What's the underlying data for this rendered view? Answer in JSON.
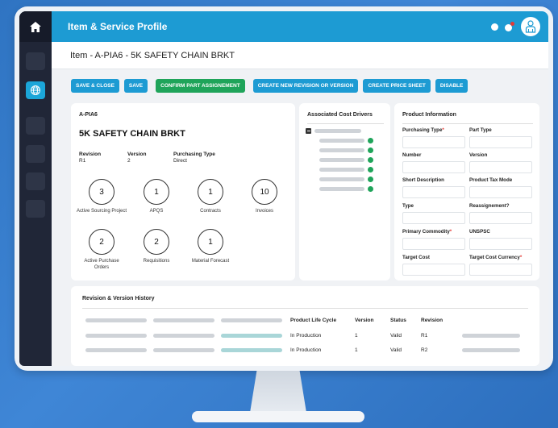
{
  "app": {
    "title": "Item & Service Profile"
  },
  "item": {
    "title": "Item - A-PIA6 - 5K SAFETY CHAIN BRKT"
  },
  "actions": {
    "save_close": "SAVE & CLOSE",
    "save": "SAVE",
    "confirm_part": "CONFIRM PART ASSIGNEMENT",
    "new_revision": "CREATE NEW REVISION OR VERSION",
    "price_sheet": "CREATE PRICE SHEET",
    "disable": "DISABLE"
  },
  "overview": {
    "code": "A-PIA6",
    "name": "5K SAFETY CHAIN BRKT",
    "revision_label": "Revision",
    "revision_value": "R1",
    "version_label": "Version",
    "version_value": "2",
    "purchasing_type_label": "Purchasing Type",
    "purchasing_type_value": "Direct",
    "metrics": [
      {
        "value": "3",
        "label": "Active Sourcing Project"
      },
      {
        "value": "1",
        "label": "APQS"
      },
      {
        "value": "1",
        "label": "Contracts"
      },
      {
        "value": "10",
        "label": "Invoices"
      },
      {
        "value": "2",
        "label": "Active Purchase Orders"
      },
      {
        "value": "2",
        "label": "Requisitions"
      },
      {
        "value": "1",
        "label": "Material Forecast"
      }
    ]
  },
  "cost_drivers": {
    "title": "Associated Cost Drivers"
  },
  "product_info": {
    "title": "Product Information",
    "fields": [
      {
        "label": "Purchasing Type",
        "required": "*"
      },
      {
        "label": "Part Type",
        "required": ""
      },
      {
        "label": "Number",
        "required": ""
      },
      {
        "label": "Version",
        "required": ""
      },
      {
        "label": "Short Description",
        "required": ""
      },
      {
        "label": "Product Tax Mode",
        "required": ""
      },
      {
        "label": "Type",
        "required": ""
      },
      {
        "label": "Reassignement?",
        "required": ""
      },
      {
        "label": "Primary Commodity",
        "required": "*"
      },
      {
        "label": "UNSPSC",
        "required": ""
      },
      {
        "label": "Target Cost",
        "required": ""
      },
      {
        "label": "Target Cost Currency",
        "required": "*"
      }
    ]
  },
  "history": {
    "title": "Revision & Version History",
    "headers": {
      "lifecycle": "Product Life Cycle",
      "version": "Version",
      "status": "Status",
      "revision": "Revision"
    },
    "rows": [
      {
        "lifecycle": "In Production",
        "version": "1",
        "status": "Valid",
        "revision": "R1"
      },
      {
        "lifecycle": "In Production",
        "version": "1",
        "status": "Valid",
        "revision": "R2"
      }
    ]
  },
  "colors": {
    "topbar": "#1d9bd3",
    "sidebar": "#202637",
    "green_button": "#1fa45a",
    "required_mark": "#e53935"
  }
}
